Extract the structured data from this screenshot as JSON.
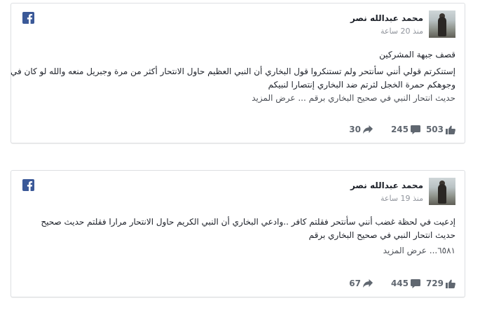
{
  "posts": [
    {
      "author": "محمد عبدالله نصر",
      "time": "منذ 20 ساعة",
      "lines": [
        "قصف جبهة المشركين",
        "إستنكرتم قولي أنني سأنتحر ولم تستنكروا قول البخاري أن النبي العظيم حاول الانتحار أكثر من مرة وجبريل منعه والله لو كان في",
        "وجوهكم حمرة الخجل لثرتم ضد البخاري إنتصارا لنبيكم",
        "حديث انتحار النبي في صحيح البخاري برقم ... عرض المزيد"
      ],
      "likes": "503",
      "comments": "245",
      "shares": "30"
    },
    {
      "author": "محمد عبدالله نصر",
      "time": "منذ 19 ساعة",
      "lines": [
        "إدعيت في لحظة غضب أنني سأنتحر فقلتم كافر ..وادعي البخاري أن النبي الكريم حاول الانتحار مرارا فقلتم حديث صحيح",
        "حديث انتحار النبي في صحيح البخاري برقم",
        "٦٥٨١... عرض المزيد"
      ],
      "likes": "729",
      "comments": "445",
      "shares": "67"
    }
  ],
  "icons": {
    "network": "facebook-icon",
    "like": "thumbs-up-icon",
    "comment": "comment-icon",
    "share": "share-icon"
  },
  "colors": {
    "facebook_blue": "#3b5998",
    "meta_gray": "#90949c",
    "action_gray": "#606770",
    "card_border": "#dddfe2"
  }
}
